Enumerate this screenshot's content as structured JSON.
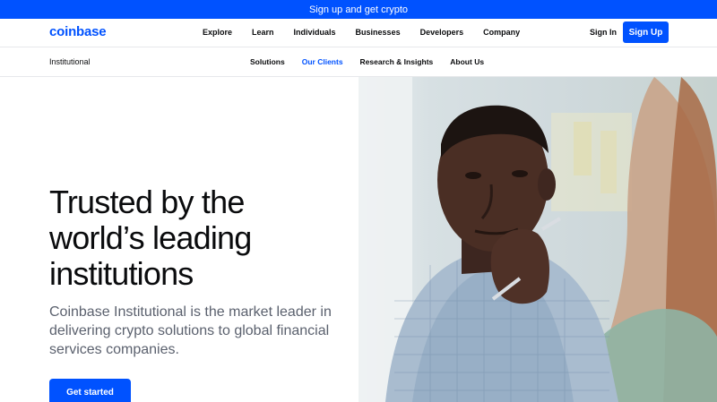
{
  "promo": {
    "text": "Sign up and get crypto"
  },
  "header": {
    "logo": "coinbase",
    "nav": [
      "Explore",
      "Learn",
      "Individuals",
      "Businesses",
      "Developers",
      "Company"
    ],
    "signin": "Sign In",
    "signup": "Sign Up"
  },
  "subnav": {
    "title": "Institutional",
    "links": [
      "Solutions",
      "Our Clients",
      "Research & Insights",
      "About Us"
    ],
    "active": "Our Clients"
  },
  "hero": {
    "title_lines": [
      "Trusted by the",
      "world’s leading",
      "institutions"
    ],
    "description": "Coinbase Institutional is the market leader in delivering crypto solutions to global financial services companies.",
    "cta": "Get started"
  },
  "colors": {
    "brand": "#0052ff",
    "text": "#0a0b0d",
    "muted": "#5b616e"
  }
}
